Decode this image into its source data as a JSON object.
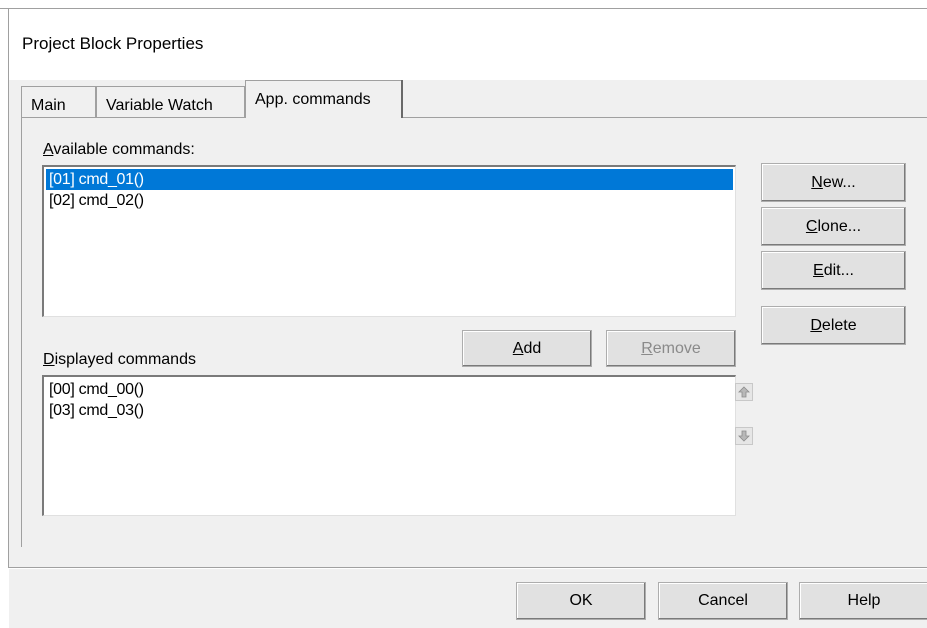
{
  "window": {
    "title": "Project Block Properties"
  },
  "tabs": [
    {
      "label": "Main",
      "active": false
    },
    {
      "label": "Variable Watch",
      "active": false
    },
    {
      "label": "App. commands",
      "active": true
    }
  ],
  "available": {
    "label_prefix": "",
    "label_mnemonic": "A",
    "label_rest": "vailable commands:",
    "items": [
      {
        "text": "[01] cmd_01()",
        "selected": true
      },
      {
        "text": "[02] cmd_02()",
        "selected": false
      }
    ]
  },
  "displayed": {
    "label_mnemonic": "D",
    "label_rest": "isplayed commands",
    "items": [
      {
        "text": "[00] cmd_00()"
      },
      {
        "text": "[03] cmd_03()"
      }
    ]
  },
  "buttons": {
    "new": {
      "mnemonic": "N",
      "rest": "ew..."
    },
    "clone": {
      "mnemonic": "C",
      "rest": "lone..."
    },
    "edit": {
      "mnemonic": "E",
      "rest": "dit..."
    },
    "delete": {
      "mnemonic": "D",
      "rest": "elete"
    },
    "add": {
      "mnemonic": "A",
      "rest": "dd"
    },
    "remove": {
      "mnemonic": "R",
      "rest": "emove",
      "disabled": true
    },
    "ok": "OK",
    "cancel": "Cancel",
    "help": "Help"
  },
  "icons": {
    "move_up": "arrow-up-icon",
    "move_down": "arrow-down-icon"
  },
  "colors": {
    "selection": "#0078d7",
    "dialog_bg": "#f0f0f0",
    "disabled_text": "#8a8a8a"
  }
}
